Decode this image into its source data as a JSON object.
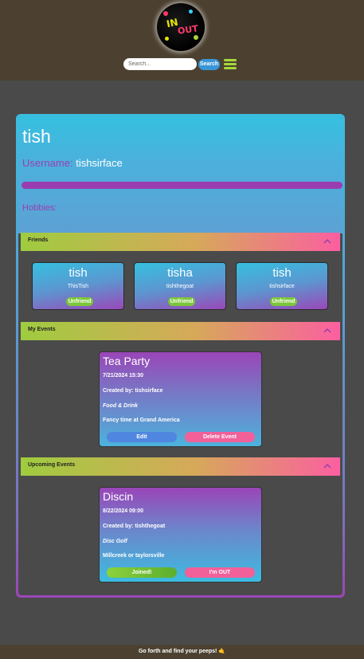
{
  "header": {
    "logo_text_in": "IN",
    "logo_text_out": "OUT",
    "search_placeholder": "Search...",
    "search_button": "Search",
    "menu_icon": "hamburger-menu-icon",
    "colors": {
      "background": "#4c4130",
      "search_button": "#3a95d8",
      "menu": "#a6d93a"
    }
  },
  "profile": {
    "name": "tish",
    "username_label": "Username:",
    "username": "tishsirface",
    "hobbies_label": "Hobbies:"
  },
  "sections": {
    "friends": {
      "title": "Friends",
      "icon": "chevron-up-icon"
    },
    "my_events": {
      "title": "My Events",
      "icon": "chevron-up-icon"
    },
    "upcoming_events": {
      "title": "Upcoming Events",
      "icon": "chevron-up-icon"
    }
  },
  "friends": [
    {
      "name": "tish",
      "username": "ThisTish",
      "action": "Unfriend"
    },
    {
      "name": "tisha",
      "username": "tishthegoat",
      "action": "Unfriend"
    },
    {
      "name": "tish",
      "username": "tishsirface",
      "action": "Unfriend"
    }
  ],
  "my_events": [
    {
      "title": "Tea Party",
      "datetime": "7/21/2024 15:30",
      "created_by": "Created by: tishsirface",
      "category": "Food & Drink",
      "description": "Fancy time at Grand America",
      "primary_action": "Edit",
      "secondary_action": "Delete Event"
    }
  ],
  "upcoming_events": [
    {
      "title": "Discin",
      "datetime": "8/22/2024 09:00",
      "created_by": "Created by: tishthegoat",
      "category": "Disc Golf",
      "description": "Millcreek or taylorsville",
      "primary_action": "Joined!",
      "secondary_action": "I'm OUT"
    }
  ],
  "footer": {
    "text": "Go forth and find your peeps! 🤙"
  },
  "colors": {
    "accent_purple": "#9a3db0",
    "accent_blue": "#35c0e0",
    "accent_green": "#7cc63a",
    "accent_pink": "#fb5fa0",
    "edit_button": "#4f86e0",
    "delete_button": "#f2609a"
  }
}
